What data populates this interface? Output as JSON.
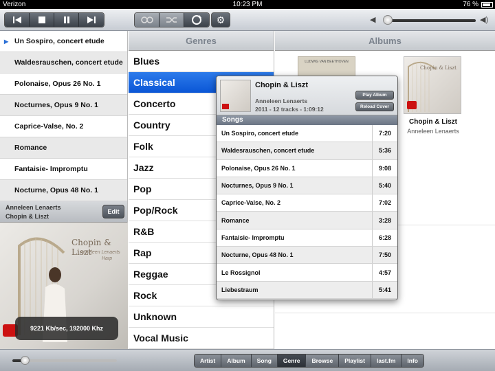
{
  "status": {
    "carrier": "Verizon",
    "time": "10:23 PM",
    "battery": "76 %"
  },
  "toolbar": {
    "transport": [
      "prev-icon",
      "stop-icon",
      "pause-icon",
      "next-icon"
    ],
    "modes": [
      "repeat-icon",
      "shuffle-icon",
      "sync-icon"
    ],
    "settings": "gear-icon",
    "volume_level": 0.02
  },
  "songlist": {
    "songs": [
      "Un Sospiro, concert etude",
      "Waldesrauschen, concert etude",
      "Polonaise, Opus 26 No. 1",
      "Nocturnes, Opus 9 No. 1",
      "Caprice-Valse, No. 2",
      "Romance",
      "Fantaisie- Impromptu",
      "Nocturne, Opus 48 No. 1"
    ]
  },
  "nowplaying": {
    "artist": "Anneleen Lenaerts",
    "album": "Chopin & Liszt",
    "edit_label": "Edit",
    "cover_title": "Chopin & Liszt",
    "cover_artist": "Anneleen Lenaerts",
    "cover_instrument": "Harp",
    "bitrate": "9221 Kb/sec, 192000 Khz"
  },
  "genres": {
    "header": "Genres",
    "items": [
      "Blues",
      "Classical",
      "Concerto",
      "Country",
      "Folk",
      "Jazz",
      "Pop",
      "Pop/Rock",
      "R&B",
      "Rap",
      "Reggae",
      "Rock",
      "Unknown",
      "Vocal Music"
    ],
    "selected": "Classical"
  },
  "albums": {
    "header": "Albums",
    "beethoven_cover_text": "LUDWIG VAN BEETHOVEN",
    "tiles": [
      {
        "title": "Chopin & Liszt",
        "artist": "Anneleen Lenaerts"
      }
    ]
  },
  "popover": {
    "title": "Chopin & Liszt",
    "artist": "Anneleen Lenaerts",
    "meta": "2011  -  12 tracks  -  1:09:12",
    "play_album": "Play Album",
    "reload_cover": "Reload Cover",
    "songs_header": "Songs",
    "songs": [
      {
        "name": "Un Sospiro, concert etude",
        "duration": "7:20"
      },
      {
        "name": "Waldesrauschen, concert etude",
        "duration": "5:36"
      },
      {
        "name": "Polonaise, Opus 26 No. 1",
        "duration": "9:08"
      },
      {
        "name": "Nocturnes, Opus 9 No. 1",
        "duration": "5:40"
      },
      {
        "name": "Caprice-Valse, No. 2",
        "duration": "7:02"
      },
      {
        "name": "Romance",
        "duration": "3:28"
      },
      {
        "name": "Fantaisie- Impromptu",
        "duration": "6:28"
      },
      {
        "name": "Nocturne, Opus 48 No. 1",
        "duration": "7:50"
      },
      {
        "name": "Le Rossignol",
        "duration": "4:57"
      },
      {
        "name": "Liebestraum",
        "duration": "5:41"
      }
    ]
  },
  "bottombar": {
    "seek_progress": 0.1,
    "tabs": [
      "Artist",
      "Album",
      "Song",
      "Genre",
      "Browse",
      "Playlist",
      "last.fm",
      "Info"
    ],
    "active_tab": "Genre"
  },
  "colors": {
    "selection_blue": "#0a56d6",
    "header_text": "#7b838d",
    "badge_red": "#cc1111"
  }
}
